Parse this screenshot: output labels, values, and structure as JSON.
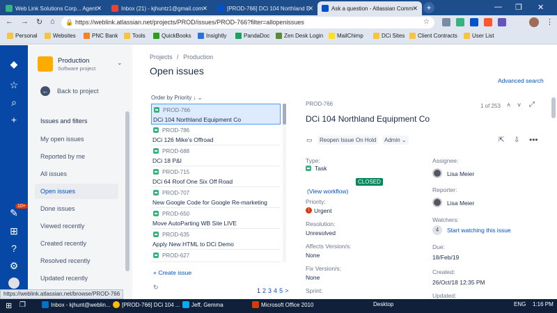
{
  "browser": {
    "tabs": [
      {
        "label": "Web Link Solutions Corp... Agent",
        "color": "#36b37e"
      },
      {
        "label": "Inbox (21) - kjhuntz1@gmail.com",
        "color": "#ea4335"
      },
      {
        "label": "[PROD-766] DCi 104 Northland E",
        "color": "#0052cc"
      },
      {
        "label": "Ask a question - Atlassian Comm",
        "color": "#0052cc"
      }
    ],
    "url": "https://weblink.atlassian.net/projects/PROD/issues/PROD-766?filter=allopenissues",
    "bookmarks": [
      "Personal",
      "Websites",
      "PNC Bank",
      "Tools",
      "QuickBooks",
      "Insightly",
      "PandaDoc",
      "Zen Desk Login",
      "MailChimp",
      "DCi Sites",
      "Client Contracts",
      "User List"
    ]
  },
  "project": {
    "name": "Production",
    "type": "Software project",
    "back_label": "Back to project",
    "section": "Issues and filters",
    "filters": [
      "My open issues",
      "Reported by me",
      "All issues",
      "Open issues",
      "Done issues",
      "Viewed recently",
      "Created recently",
      "Resolved recently",
      "Updated recently"
    ],
    "badge": "10+"
  },
  "breadcrumb": {
    "projects": "Projects",
    "sep": "/",
    "project": "Production"
  },
  "page_title": "Open issues",
  "advanced_search": "Advanced search",
  "order_by": "Order by Priority",
  "issues": [
    {
      "key": "PROD-766",
      "summary": "DCi 104 Northland Equipment Co"
    },
    {
      "key": "PROD-786",
      "summary": "DCi 126 Mike's Offroad"
    },
    {
      "key": "PROD-688",
      "summary": "DCi 18 P&I"
    },
    {
      "key": "PROD-715",
      "summary": "DCi 64 Roof One Six Off Road"
    },
    {
      "key": "PROD-707",
      "summary": "New Google Code for Google Re-marketing"
    },
    {
      "key": "PROD-650",
      "summary": "Move AutoParting WB Site LIVE"
    },
    {
      "key": "PROD-635",
      "summary": "Apply New HTML to DCi Demo"
    },
    {
      "key": "PROD-627",
      "summary": ""
    }
  ],
  "create_issue": "+ Create issue",
  "pagination": [
    "1",
    "2",
    "3",
    "4",
    "5",
    ">"
  ],
  "detail": {
    "key": "PROD-766",
    "title": "DCi 104 Northland Equipment Co",
    "counter": "1 of 253",
    "actions": {
      "reopen": "Reopen Issue",
      "hold": "On Hold",
      "admin": "Admin"
    },
    "type_label": "Type:",
    "type_value": "Task",
    "status": "CLOSED",
    "view_workflow": "(View workflow)",
    "priority_label": "Priority:",
    "priority_value": "Urgent",
    "resolution_label": "Resolution:",
    "resolution_value": "Unresolved",
    "affects_label": "Affects Version/s:",
    "affects_value": "None",
    "fix_label": "Fix Version/s:",
    "fix_value": "None",
    "sprint_label": "Sprint:",
    "assignee_label": "Assignee:",
    "assignee_value": "Lisa Meier",
    "reporter_label": "Reporter:",
    "reporter_value": "Lisa Meier",
    "watchers_label": "Watchers:",
    "watchers_count": "4",
    "watch_link": "Start watching this issue",
    "due_label": "Due:",
    "due_value": "18/Feb/19",
    "created_label": "Created:",
    "created_value": "26/Oct/18 12:35 PM",
    "updated_label": "Updated:"
  },
  "status_url": "https://weblink.atlassian.net/browse/PROD-766",
  "taskbar": {
    "items": [
      "Inbox - kjhunt@weblin...",
      "[PROD-766] DCi 104 ...",
      "Jeff, Gemma",
      "Microsoft Office 2010"
    ],
    "desktop": "Desktop",
    "lang": "ENG",
    "time": "1:16 PM"
  },
  "colors": {
    "nav": "#0747a6",
    "accent": "#0052cc",
    "closed": "#00875a",
    "urgent": "#de350b"
  }
}
